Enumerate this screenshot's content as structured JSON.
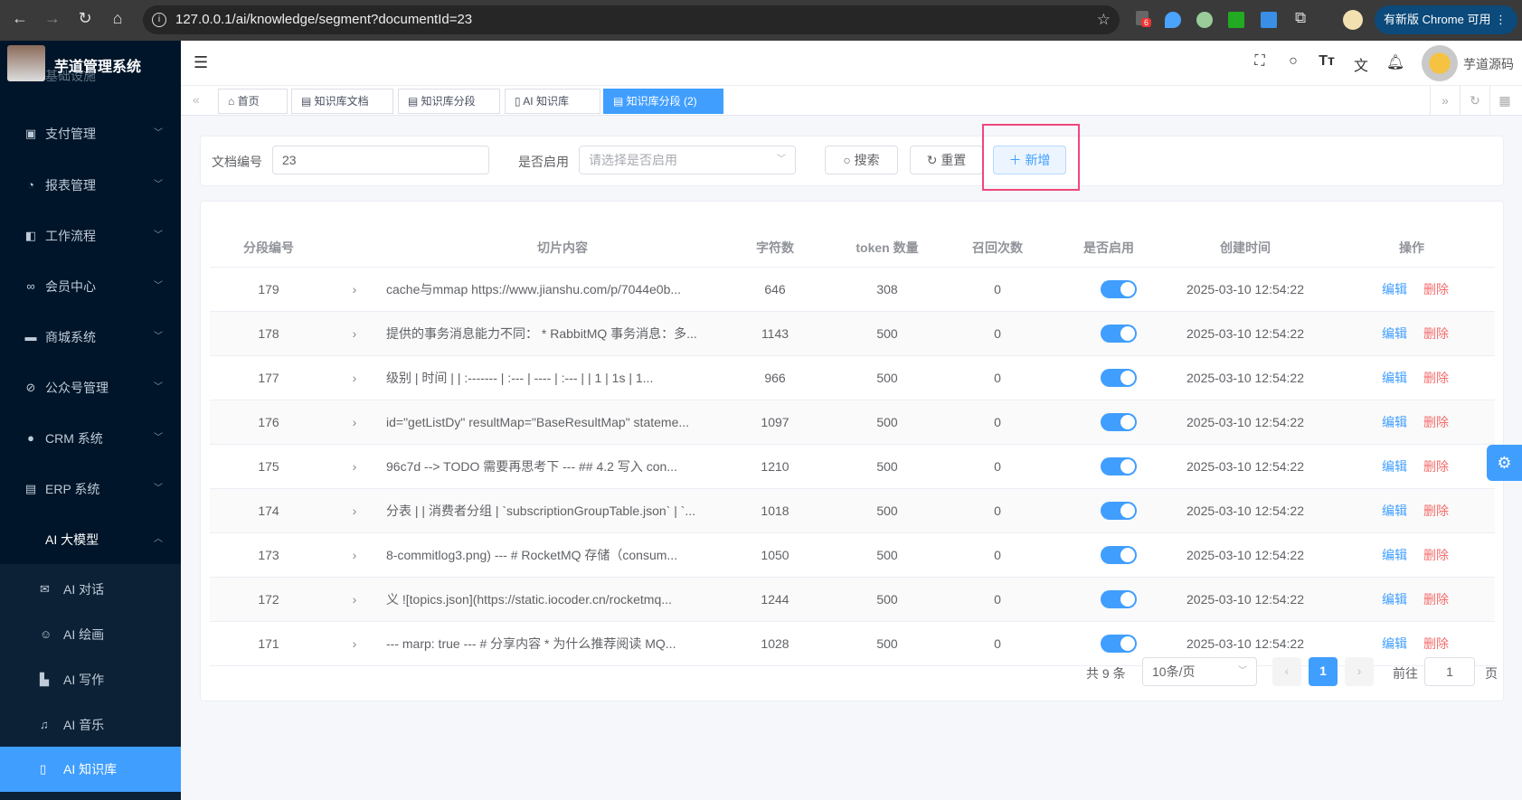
{
  "browser": {
    "url": "127.0.0.1/ai/knowledge/segment?documentId=23",
    "extension_badge": "6",
    "update_label": "有新版 Chrome 可用"
  },
  "sidebar": {
    "title": "芋道管理系统",
    "items": [
      {
        "label": "基础设施",
        "icon": "monitor-icon"
      },
      {
        "label": "支付管理",
        "icon": "wallet-icon"
      },
      {
        "label": "报表管理",
        "icon": "pie-chart-icon"
      },
      {
        "label": "工作流程",
        "icon": "workflow-icon"
      },
      {
        "label": "会员中心",
        "icon": "bicycle-icon"
      },
      {
        "label": "商城系统",
        "icon": "shop-icon"
      },
      {
        "label": "公众号管理",
        "icon": "compass-icon"
      },
      {
        "label": "CRM 系统",
        "icon": "user-icon"
      },
      {
        "label": "ERP 系统",
        "icon": "store-icon"
      },
      {
        "label": "AI 大模型",
        "icon": "apple-icon",
        "expanded": true
      }
    ],
    "subitems": [
      {
        "label": "AI 对话",
        "icon": "mail-icon"
      },
      {
        "label": "AI 绘画",
        "icon": "palette-icon"
      },
      {
        "label": "AI 写作",
        "icon": "book-icon"
      },
      {
        "label": "AI 音乐",
        "icon": "music-icon"
      },
      {
        "label": "AI 知识库",
        "icon": "notebook-icon",
        "active": true
      }
    ]
  },
  "navbar": {
    "username": "芋道源码"
  },
  "tags": [
    {
      "label": "首页"
    },
    {
      "label": "知识库文档"
    },
    {
      "label": "知识库分段"
    },
    {
      "label": "AI 知识库"
    },
    {
      "label": "知识库分段 (2)",
      "active": true
    }
  ],
  "search": {
    "doc_label": "文档编号",
    "doc_value": "23",
    "enable_label": "是否启用",
    "enable_placeholder": "请选择是否启用",
    "search_btn": "搜索",
    "reset_btn": "重置",
    "add_btn": "新增"
  },
  "table": {
    "headers": [
      "分段编号",
      "切片内容",
      "字符数",
      "token 数量",
      "召回次数",
      "是否启用",
      "创建时间",
      "操作"
    ],
    "edit": "编辑",
    "delete": "删除",
    "rows": [
      {
        "id": "179",
        "content": "cache与mmap https://www.jianshu.com/p/7044e0b...",
        "chars": "646",
        "tokens": "308",
        "recall": "0",
        "enabled": true,
        "time": "2025-03-10 12:54:22"
      },
      {
        "id": "178",
        "content": "提供的事务消息能力不同： * RabbitMQ 事务消息：多...",
        "chars": "1143",
        "tokens": "500",
        "recall": "0",
        "enabled": true,
        "time": "2025-03-10 12:54:22"
      },
      {
        "id": "177",
        "content": "级别 | 时间 | | :------- | :--- | ---- | :--- | | 1 | 1s | 1...",
        "chars": "966",
        "tokens": "500",
        "recall": "0",
        "enabled": true,
        "time": "2025-03-10 12:54:22"
      },
      {
        "id": "176",
        "content": "id=\"getListDy\" resultMap=\"BaseResultMap\" stateme...",
        "chars": "1097",
        "tokens": "500",
        "recall": "0",
        "enabled": true,
        "time": "2025-03-10 12:54:22"
      },
      {
        "id": "175",
        "content": "96c7d --> TODO 需要再思考下 --- ## 4.2 写入 con...",
        "chars": "1210",
        "tokens": "500",
        "recall": "0",
        "enabled": true,
        "time": "2025-03-10 12:54:22"
      },
      {
        "id": "174",
        "content": "分表 | | 消费者分组 | `subscriptionGroupTable.json` | `...",
        "chars": "1018",
        "tokens": "500",
        "recall": "0",
        "enabled": true,
        "time": "2025-03-10 12:54:22"
      },
      {
        "id": "173",
        "content": "8-commitlog3.png) --- # RocketMQ 存储（consum...",
        "chars": "1050",
        "tokens": "500",
        "recall": "0",
        "enabled": true,
        "time": "2025-03-10 12:54:22"
      },
      {
        "id": "172",
        "content": "义 ![topics.json](https://static.iocoder.cn/rocketmq...",
        "chars": "1244",
        "tokens": "500",
        "recall": "0",
        "enabled": true,
        "time": "2025-03-10 12:54:22"
      },
      {
        "id": "171",
        "content": "--- marp: true --- # 分享内容 * 为什么推荐阅读 MQ...",
        "chars": "1028",
        "tokens": "500",
        "recall": "0",
        "enabled": true,
        "time": "2025-03-10 12:54:22"
      }
    ]
  },
  "pagination": {
    "total": "共 9 条",
    "page_size": "10条/页",
    "current": "1",
    "goto_label": "前往",
    "goto_value": "1",
    "page_suffix": "页"
  },
  "colors": {
    "primary": "#409eff",
    "danger": "#f56c6c",
    "sidebar": "#001529",
    "highlight": "#f0477b"
  }
}
